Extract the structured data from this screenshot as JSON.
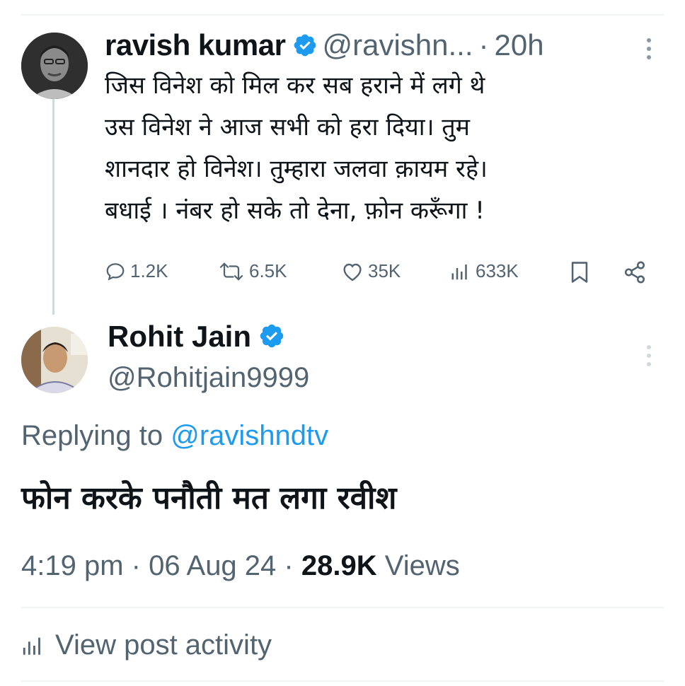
{
  "original_post": {
    "author_name": "ravish kumar",
    "handle": "@ravishn...",
    "separator": "·",
    "time_ago": "20h",
    "text_lines": [
      "जिस विनेश को मिल कर सब हराने में लगे थे",
      "उस विनेश ने आज सभी को हरा दिया। तुम",
      "शानदार हो विनेश। तुम्हारा जलवा क़ायम रहे।",
      "बधाई । नंबर हो सके तो देना, फ़ोन करूँगा !"
    ],
    "stats": {
      "replies": "1.2K",
      "reposts": "6.5K",
      "likes": "35K",
      "views": "633K"
    }
  },
  "reply_post": {
    "author_name": "Rohit Jain",
    "handle": "@Rohitjain9999",
    "replying_prefix": "Replying to",
    "replying_to": "@ravishndtv",
    "text": "फोन करके पनौती मत लगा रवीश",
    "time": "4:19 pm",
    "date": "06 Aug 24",
    "separator": "·",
    "views_count": "28.9K",
    "views_label": "Views",
    "activity_label": "View post activity"
  },
  "colors": {
    "primary_text": "#0f1419",
    "secondary_text": "#536471",
    "link": "#1d9bf0",
    "verified": "#1d9bf0",
    "divider": "#eff3f4"
  }
}
